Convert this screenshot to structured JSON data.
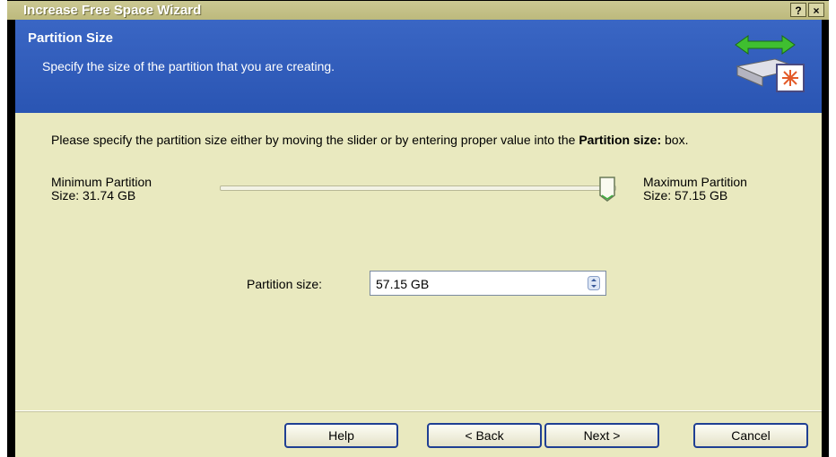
{
  "window": {
    "title": "Increase Free Space Wizard",
    "help_button": "?",
    "close_button": "×"
  },
  "header": {
    "title": "Partition Size",
    "subtitle": "Specify the size of the partition that you are creating."
  },
  "content": {
    "instruction_prefix": "Please specify the partition size either by moving the slider or by entering proper value into the ",
    "instruction_bold": "Partition size:",
    "instruction_suffix": " box.",
    "min_label_line1": "Minimum Partition",
    "min_label_line2": "Size: 31.74 GB",
    "max_label_line1": "Maximum Partition",
    "max_label_line2": "Size: 57.15 GB",
    "slider_value_fraction": 1.0,
    "size_label": "Partition size:",
    "size_value": "57.15 GB"
  },
  "buttons": {
    "help": "Help",
    "back": "< Back",
    "next": "Next >",
    "cancel": "Cancel"
  },
  "colors": {
    "header_bg": "#2a55b3",
    "body_bg": "#e9e9bf",
    "titlebar": "#bdb97c",
    "button_border": "#1f3f93"
  }
}
